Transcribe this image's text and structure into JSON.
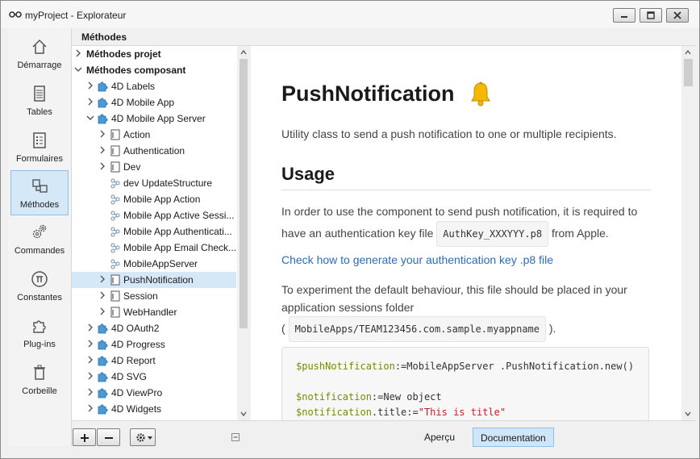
{
  "window": {
    "title": "myProject - Explorateur",
    "accent": "#d5e8f8"
  },
  "sidebar": {
    "items": [
      {
        "label": "Démarrage",
        "icon": "home-icon"
      },
      {
        "label": "Tables",
        "icon": "tables-icon"
      },
      {
        "label": "Formulaires",
        "icon": "forms-icon"
      },
      {
        "label": "Méthodes",
        "icon": "methods-icon",
        "active": true
      },
      {
        "label": "Commandes",
        "icon": "gears-icon"
      },
      {
        "label": "Constantes",
        "icon": "pi-icon"
      },
      {
        "label": "Plug-ins",
        "icon": "puzzle-icon"
      },
      {
        "label": "Corbeille",
        "icon": "trash-icon"
      }
    ]
  },
  "section_title": "Méthodes",
  "tree": {
    "rows": [
      {
        "label": "Méthodes projet",
        "bold": true
      },
      {
        "label": "Méthodes composant",
        "bold": true
      },
      {
        "label": "4D Labels"
      },
      {
        "label": "4D Mobile App"
      },
      {
        "label": "4D Mobile App Server"
      },
      {
        "label": "Action"
      },
      {
        "label": "Authentication"
      },
      {
        "label": "Dev"
      },
      {
        "label": "dev UpdateStructure"
      },
      {
        "label": "Mobile App Action"
      },
      {
        "label": "Mobile App Active Sessi..."
      },
      {
        "label": "Mobile App Authenticati..."
      },
      {
        "label": "Mobile App Email Check..."
      },
      {
        "label": "MobileAppServer"
      },
      {
        "label": "PushNotification",
        "selected": true
      },
      {
        "label": "Session"
      },
      {
        "label": "WebHandler"
      },
      {
        "label": "4D OAuth2"
      },
      {
        "label": "4D Progress"
      },
      {
        "label": "4D Report"
      },
      {
        "label": "4D SVG"
      },
      {
        "label": "4D ViewPro"
      },
      {
        "label": "4D Widgets"
      }
    ]
  },
  "doc": {
    "title": "PushNotification",
    "intro": "Utility class to send a push notification to one or multiple recipients.",
    "usage_heading": "Usage",
    "para1_line1": "In order to use the component to send push notification, it is required to",
    "para1_line2_pre": "have an authentication key file",
    "para1_code": "AuthKey_XXXYYY.p8",
    "para1_line2_post": "from Apple.",
    "link": "Check how to generate your authentication key .p8 file",
    "para2_line1": "To experiment the default behaviour, this file should be placed in your",
    "para2_line2": "application sessions folder",
    "para2_open": "(",
    "para2_code": "MobileApps/TEAM123456.com.sample.myappname",
    "para2_close": ").",
    "code": {
      "l1_var": "$pushNotification",
      "l1_rest": ":=MobileAppServer .PushNotification.new()",
      "l2_var": "$notification",
      "l2_rest": ":=New object",
      "l3_var": "$notification",
      "l3_mid": ".title:=",
      "l3_str": "\"This is title\""
    }
  },
  "bottombar": {
    "apercu": "Aperçu",
    "documentation": "Documentation"
  }
}
